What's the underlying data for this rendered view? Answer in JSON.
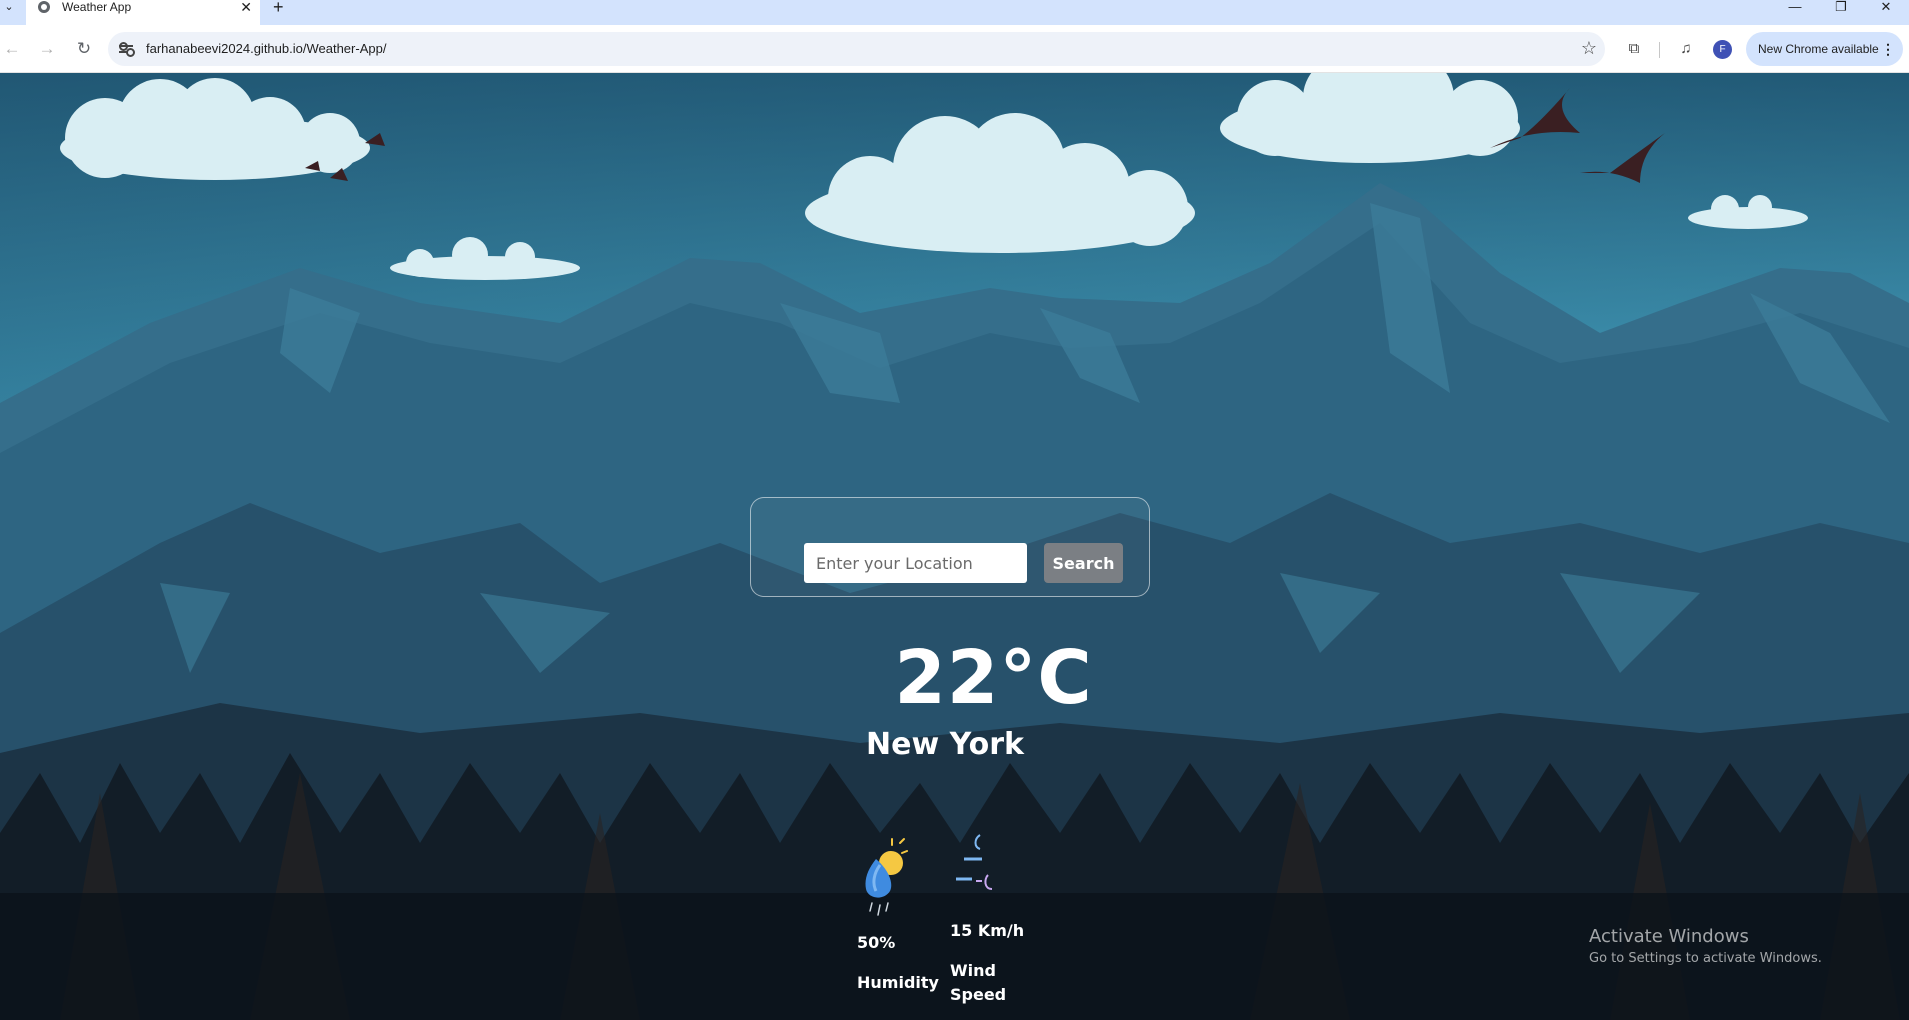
{
  "browser": {
    "tab_title": "Weather App",
    "tab_close": "✕",
    "new_tab": "+",
    "url": "farhanabeevi2024.github.io/Weather-App/",
    "profile_initial": "F",
    "update_label": "New Chrome available",
    "update_menu": "⋮",
    "window_controls": {
      "minimize": "—",
      "maximize": "❐",
      "close": "✕"
    }
  },
  "app": {
    "search": {
      "placeholder": "Enter your Location",
      "value": "",
      "button_label": "Search"
    },
    "temperature": "22°C",
    "city": "New York",
    "humidity": {
      "value": "50%",
      "label": "Humidity",
      "icon": "rain-cloud-icon"
    },
    "wind": {
      "value": "15 Km/h",
      "label": "Wind Speed",
      "icon": "wind-icon"
    }
  },
  "os_watermark": {
    "title": "Activate Windows",
    "subtitle": "Go to Settings to activate Windows."
  },
  "colors": {
    "sky_top": "#1e5b78",
    "sky_bottom": "#a8e4ea",
    "mountain": "#2c5f7b",
    "forest": "#0e1620",
    "search_button": "#7b7f84",
    "tab_strip": "#d3e3fd"
  }
}
